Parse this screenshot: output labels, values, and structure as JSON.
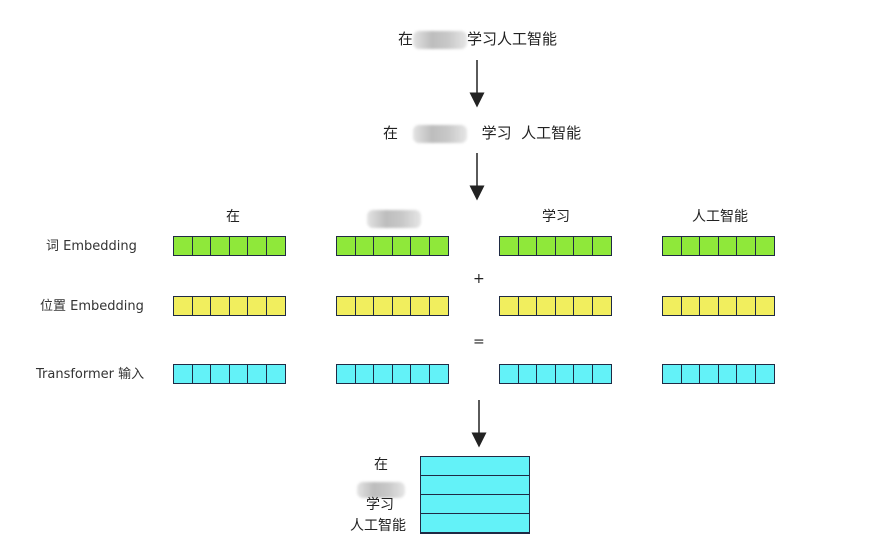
{
  "sentence_top": {
    "pre": "在",
    "post": "学习人工智能"
  },
  "sentence_split": {
    "t1": "在",
    "t3": "学习",
    "t4": "人工智能"
  },
  "tokens": [
    "在",
    "",
    "学习",
    "人工智能"
  ],
  "row_labels": {
    "word": "词 Embedding",
    "position": "位置 Embedding",
    "input": "Transformer 输入"
  },
  "operators": {
    "plus": "+",
    "equals": "="
  },
  "matrix_labels": [
    "在",
    "",
    "学习",
    "人工智能"
  ],
  "colors": {
    "word": "#8fe83a",
    "position": "#f1ee5e",
    "input": "#63f2f8",
    "border": "#1f2a44"
  },
  "vector_length": 6,
  "matrix": {
    "rows": 4,
    "cols": 6
  }
}
